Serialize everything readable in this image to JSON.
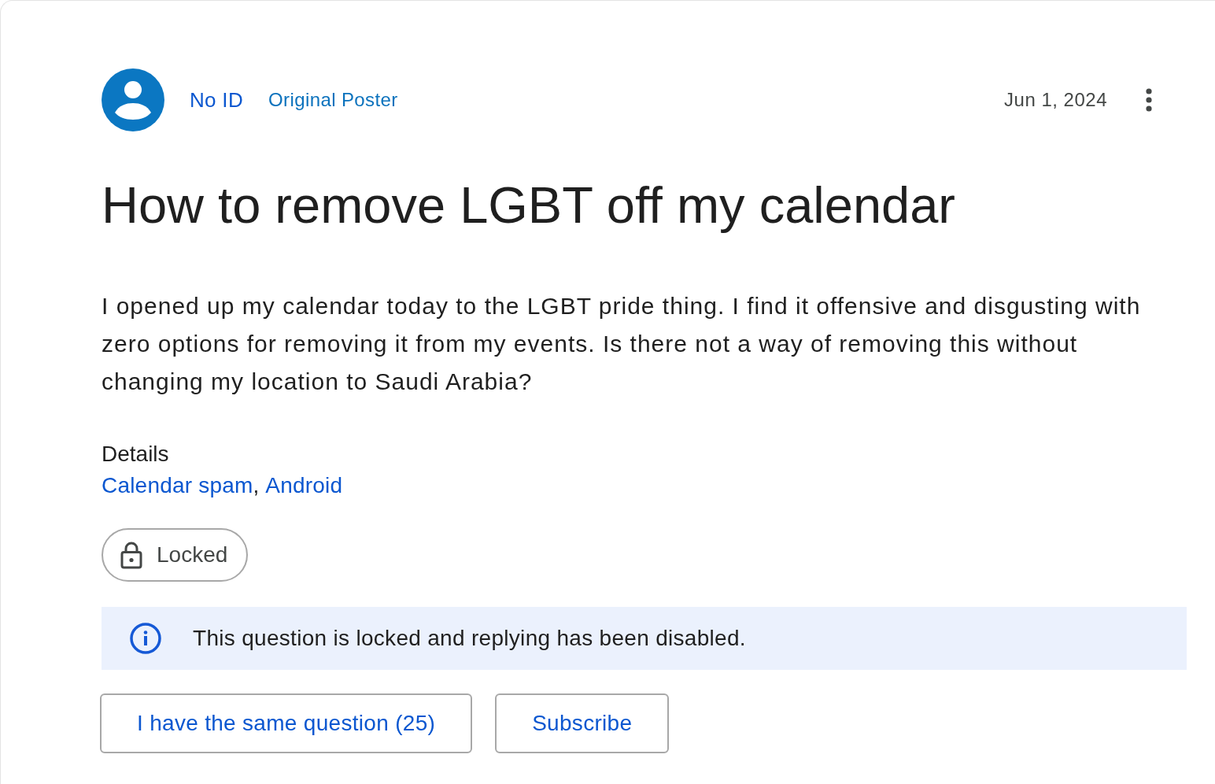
{
  "post": {
    "author": {
      "name": "No ID",
      "badge": "Original Poster"
    },
    "date": "Jun 1, 2024",
    "title": "How to remove LGBT off my calendar",
    "body": "I opened up my calendar today to the LGBT pride thing. I find it offensive and disgusting with zero options for removing it from my events. Is there not a way of removing this without changing my location to Saudi Arabia?",
    "details": {
      "label": "Details",
      "tags": [
        "Calendar spam",
        "Android"
      ],
      "separator": ","
    },
    "status_chip": {
      "label": "Locked",
      "locked": true
    },
    "notice": "This question is locked and replying has been disabled.",
    "buttons": [
      {
        "label": "I have the same question (25)"
      },
      {
        "label": "Subscribe"
      }
    ]
  }
}
